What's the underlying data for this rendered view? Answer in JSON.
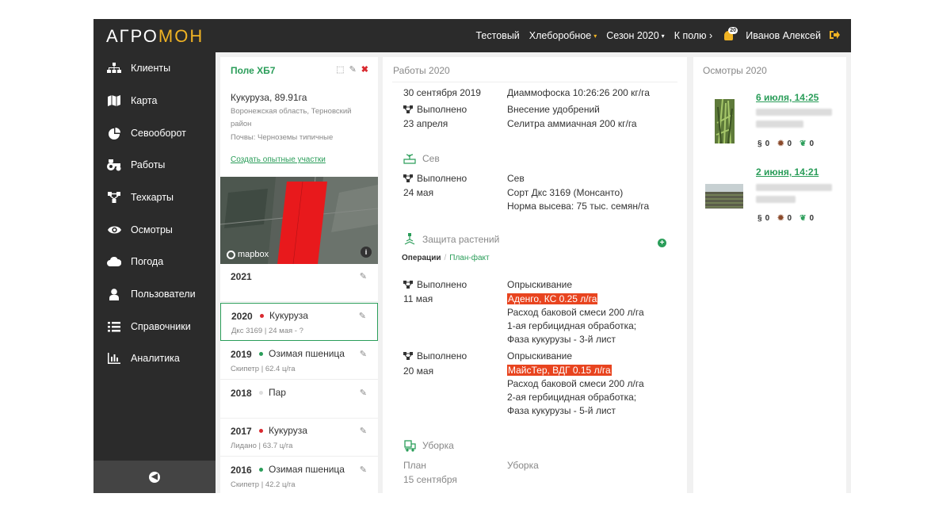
{
  "logo": {
    "main": "АГРО",
    "accent": "МОН"
  },
  "topbar": {
    "org": "Тестовый",
    "farm": "Хлеборобное",
    "season": "Сезон 2020",
    "to_field": "К полю ›",
    "notif_count": "20",
    "user": "Иванов Алексей"
  },
  "sidebar": {
    "items": [
      {
        "label": "Клиенты",
        "icon": "sitemap-icon"
      },
      {
        "label": "Карта",
        "icon": "map-icon"
      },
      {
        "label": "Севооборот",
        "icon": "pie-chart-icon"
      },
      {
        "label": "Работы",
        "icon": "tractor-icon"
      },
      {
        "label": "Техкарты",
        "icon": "flow-icon"
      },
      {
        "label": "Осмотры",
        "icon": "eye-icon"
      },
      {
        "label": "Погода",
        "icon": "cloud-icon"
      },
      {
        "label": "Пользователи",
        "icon": "user-icon"
      },
      {
        "label": "Справочники",
        "icon": "list-icon"
      },
      {
        "label": "Аналитика",
        "icon": "bar-chart-icon"
      }
    ]
  },
  "field": {
    "title": "Поле ХБ7",
    "crop_area": "Кукуруза, 89.91га",
    "region": "Воронежская область, Терновский район",
    "soil": "Почвы: Черноземы типичные",
    "create_link": "Создать опытные участки",
    "map_brand": "mapbox",
    "seasons": [
      {
        "year": "2021",
        "crop": "",
        "detail": "",
        "dot": ""
      },
      {
        "year": "2020",
        "crop": "Кукуруза",
        "detail": "Дкс 3169 | 24 мая - ?",
        "dot": "#d9292f"
      },
      {
        "year": "2019",
        "crop": "Озимая пшеница",
        "detail": "Скипетр | 62.4 ц/га",
        "dot": "#2a9d59"
      },
      {
        "year": "2018",
        "crop": "Пар",
        "detail": "",
        "dot": "#dddddd"
      },
      {
        "year": "2017",
        "crop": "Кукуруза",
        "detail": "Лидано | 63.7 ц/га",
        "dot": "#d9292f"
      },
      {
        "year": "2016",
        "crop": "Озимая пшеница",
        "detail": "Скипетр | 42.2 ц/га",
        "dot": "#2a9d59"
      }
    ]
  },
  "works": {
    "title": "Работы 2020",
    "row0": {
      "date": "30 сентября 2019",
      "desc": "Диаммофоска 10:26:26 200 кг/га"
    },
    "row1": {
      "status": "Выполнено",
      "date": "23 апреля",
      "l1": "Внесение удобрений",
      "l2": "Селитра аммиачная 200 кг/га"
    },
    "sowing": {
      "title": "Сев",
      "status": "Выполнено",
      "date": "24 мая",
      "l1": "Сев",
      "l2": "Сорт Дкс 3169 (Монсанто)",
      "l3": "Норма высева: 75 тыс. семян/га"
    },
    "protection": {
      "title": "Защита растений",
      "tab_ops": "Операции",
      "tab_sep": "/",
      "tab_plan": "План-факт",
      "op1": {
        "status": "Выполнено",
        "date": "11 мая",
        "l1": "Опрыскивание",
        "hl": "Аденго, КС 0.25 л/га",
        "l2": "Расход баковой смеси 200 л/га",
        "l3": "1-ая гербицидная обработка;",
        "l4": "Фаза кукурузы - 3-й лист"
      },
      "op2": {
        "status": "Выполнено",
        "date": "20 мая",
        "l1": "Опрыскивание",
        "hl": "МайсТер, ВДГ 0.15 л/га",
        "l2": "Расход баковой смеси 200 л/га",
        "l3": "2-ая гербицидная обработка;",
        "l4": "Фаза кукурузы - 5-й лист"
      }
    },
    "harvest": {
      "title": "Уборка",
      "status": "План",
      "date": "15 сентября",
      "l1": "Уборка"
    }
  },
  "inspections": {
    "title": "Осмотры 2020",
    "items": [
      {
        "date": "6 июля, 14:25",
        "pests": "0",
        "diseases": "0",
        "weeds": "0"
      },
      {
        "date": "2 июня, 14:21",
        "pests": "0",
        "diseases": "0",
        "weeds": "0"
      }
    ]
  },
  "colors": {
    "accent": "#f0b323",
    "green": "#2a9d59",
    "highlight": "#e8441f",
    "dark": "#2b2b2b"
  }
}
